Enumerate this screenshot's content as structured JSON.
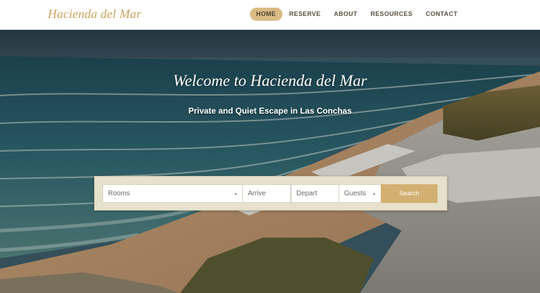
{
  "brand": {
    "name": "Hacienda del Mar"
  },
  "nav": {
    "items": [
      {
        "label": "HOME",
        "active": true
      },
      {
        "label": "RESERVE",
        "active": false
      },
      {
        "label": "ABOUT",
        "active": false
      },
      {
        "label": "RESOURCES",
        "active": false
      },
      {
        "label": "CONTACT",
        "active": false
      }
    ]
  },
  "hero": {
    "title": "Welcome to Hacienda del Mar",
    "subtitle": "Private and Quiet Escape in Las Conchas",
    "background_image": "ocean-beach-cliff-photo"
  },
  "booking": {
    "rooms_placeholder": "Rooms",
    "arrive_placeholder": "Arrive",
    "depart_placeholder": "Depart",
    "guests_placeholder": "Guests",
    "search_label": "Search",
    "dropdown_icon": "caret-down-icon"
  },
  "colors": {
    "brand_gold": "#c9a35c",
    "nav_active_bg": "#d9bb85",
    "booking_panel_bg": "#e6e1cc",
    "search_button_bg": "#d3b072"
  }
}
